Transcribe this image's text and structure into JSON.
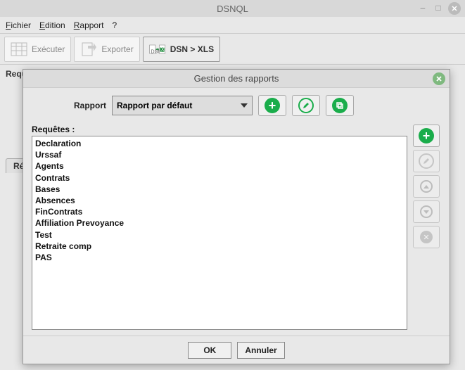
{
  "window": {
    "title": "DSNQL"
  },
  "menu": {
    "fichier": "Fichier",
    "edition": "Edition",
    "rapport": "Rapport",
    "help": "?"
  },
  "toolbar": {
    "executer": "Exécuter",
    "exporter": "Exporter",
    "dsnxls": "DSN > XLS"
  },
  "bg": {
    "requete_label": "Requête DSNQL",
    "tab_resultats": "Résultats"
  },
  "modal": {
    "title": "Gestion des rapports",
    "rapport_label": "Rapport",
    "selected_report": "Rapport par défaut",
    "requetes_label": "Requêtes :",
    "items": [
      "Declaration",
      "Urssaf",
      "Agents",
      "Contrats",
      "Bases",
      "Absences",
      "FinContrats",
      "Affiliation Prevoyance",
      "Test",
      "Retraite comp",
      "PAS"
    ],
    "ok": "OK",
    "annuler": "Annuler"
  }
}
